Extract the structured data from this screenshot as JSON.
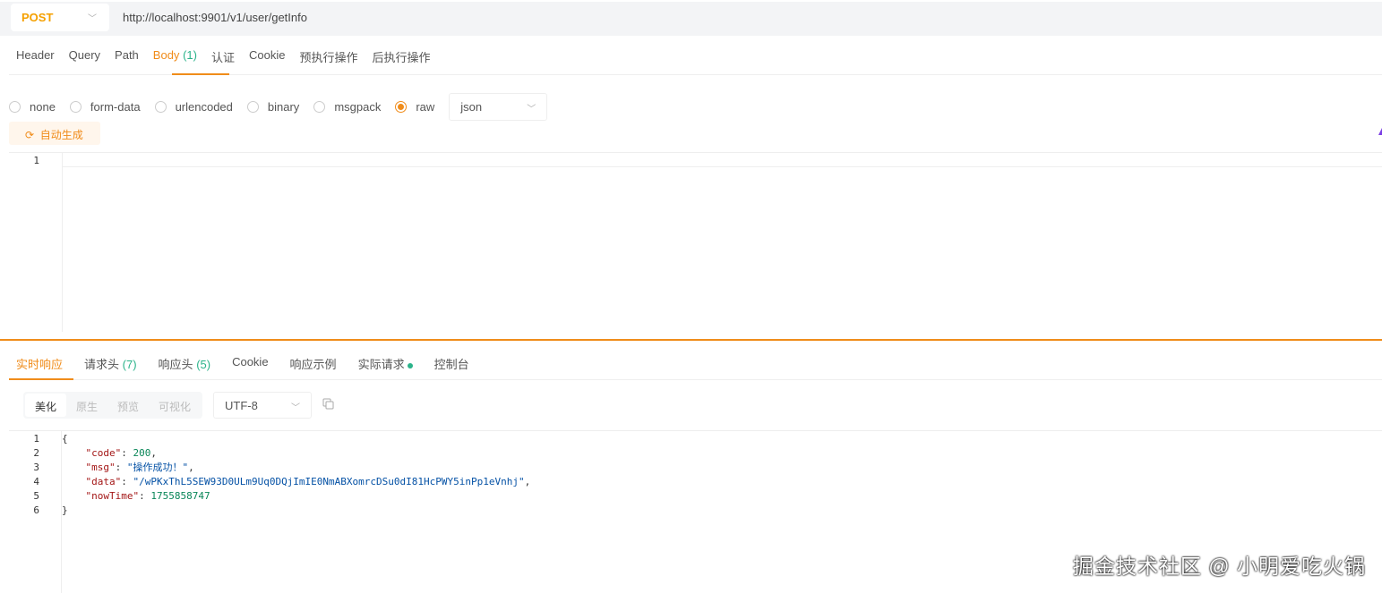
{
  "request": {
    "method": "POST",
    "url": "http://localhost:9901/v1/user/getInfo"
  },
  "tabs": [
    {
      "label": "Header"
    },
    {
      "label": "Query"
    },
    {
      "label": "Path"
    },
    {
      "label": "Body",
      "count": "(1)"
    },
    {
      "label": "认证"
    },
    {
      "label": "Cookie"
    },
    {
      "label": "预执行操作"
    },
    {
      "label": "后执行操作"
    }
  ],
  "body_types": [
    "none",
    "form-data",
    "urlencoded",
    "binary",
    "msgpack",
    "raw"
  ],
  "selected_body_type": "raw",
  "raw_format": "json",
  "auto_generate_label": "自动生成",
  "editor_lines": [
    "1"
  ],
  "response_tabs": [
    {
      "label": "实时响应"
    },
    {
      "label": "请求头",
      "count": "(7)"
    },
    {
      "label": "响应头",
      "count": "(5)"
    },
    {
      "label": "Cookie"
    },
    {
      "label": "响应示例"
    },
    {
      "label": "实际请求"
    },
    {
      "label": "控制台"
    }
  ],
  "view_modes": [
    "美化",
    "原生",
    "预览",
    "可视化"
  ],
  "encoding": "UTF-8",
  "response_lines": [
    {
      "n": "1",
      "parts": [
        [
          "p",
          "{"
        ]
      ]
    },
    {
      "n": "2",
      "parts": [
        [
          "p",
          "    "
        ],
        [
          "k",
          "\"code\""
        ],
        [
          "p",
          ": "
        ],
        [
          "n",
          "200"
        ],
        [
          "p",
          ","
        ]
      ]
    },
    {
      "n": "3",
      "parts": [
        [
          "p",
          "    "
        ],
        [
          "k",
          "\"msg\""
        ],
        [
          "p",
          ": "
        ],
        [
          "s",
          "\"操作成功！\""
        ],
        [
          "p",
          ","
        ]
      ]
    },
    {
      "n": "4",
      "parts": [
        [
          "p",
          "    "
        ],
        [
          "k",
          "\"data\""
        ],
        [
          "p",
          ": "
        ],
        [
          "s",
          "\"/wPKxThL5SEW93D0ULm9Uq0DQjImIE0NmABXomrcDSu0dI81HcPWY5inPp1eVnhj\""
        ],
        [
          "p",
          ","
        ]
      ]
    },
    {
      "n": "5",
      "parts": [
        [
          "p",
          "    "
        ],
        [
          "k",
          "\"nowTime\""
        ],
        [
          "p",
          ": "
        ],
        [
          "n",
          "1755858747"
        ]
      ]
    },
    {
      "n": "6",
      "parts": [
        [
          "p",
          "}"
        ]
      ]
    }
  ],
  "watermark": "掘金技术社区 @ 小明爱吃火锅",
  "colors": {
    "accent": "#f08c1a",
    "count": "#2bb38a",
    "method": "#f5a000"
  }
}
